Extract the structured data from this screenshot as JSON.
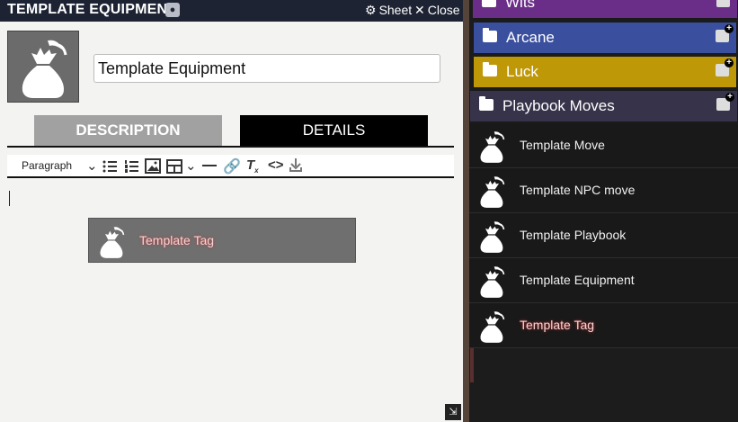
{
  "sheet": {
    "title": "TEMPLATE EQUIPMENT",
    "sheet_label": "Sheet",
    "close_label": "Close",
    "name_value": "Template Equipment",
    "tabs": [
      {
        "label": "DESCRIPTION"
      },
      {
        "label": "DETAILS"
      }
    ],
    "toolbar": {
      "paragraph_select": "Paragraph"
    },
    "tag_label": "Template Tag"
  },
  "panel": {
    "folders": [
      {
        "label": "Wits",
        "color": "#6a2e88"
      },
      {
        "label": "Arcane",
        "color": "#3a4f9e"
      },
      {
        "label": "Luck",
        "color": "#bf9808"
      },
      {
        "label": "Playbook Moves",
        "color": "#36334a"
      }
    ],
    "items": [
      {
        "label": "Template Move"
      },
      {
        "label": "Template NPC move"
      },
      {
        "label": "Template Playbook"
      },
      {
        "label": "Template Equipment"
      },
      {
        "label": "Template Tag"
      }
    ]
  },
  "icons": {
    "item_icon": "sack-icon",
    "folder_icon": "folder-icon",
    "add_icon": "add-to-folder-icon"
  }
}
